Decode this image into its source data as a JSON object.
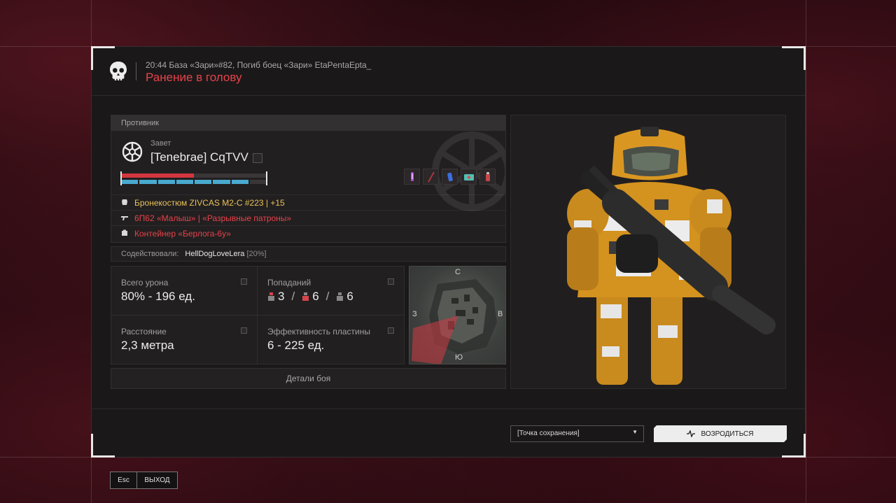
{
  "header": {
    "event_line": "20:44 База «Зари»#82, Погиб боец «Зари» EtaPentaEpta_",
    "death_cause": "Ранение в голову"
  },
  "enemy": {
    "section_title": "Противник",
    "faction": "Завет",
    "player_name": "[Tenebrae] CqTVV",
    "health_fraction": 0.5,
    "armor_fraction": 0.88,
    "items": [
      "syringe-icon",
      "knife-icon",
      "battery-icon",
      "medkit-icon",
      "stimulant-icon"
    ],
    "loadout": {
      "armor": "Бронекостюм ZIVCAS M2-C #223 | +15",
      "weapon": "6П62 «Малыш» | «Разрывные патроны»",
      "container": "Контейнер «Берлога-6у»"
    }
  },
  "assist": {
    "label": "Содействовали:",
    "name": "HellDogLoveLera",
    "percent": "[20%]"
  },
  "stats": {
    "damage_label": "Всего урона",
    "damage_value": "80% - 196 ед.",
    "hits_label": "Попаданий",
    "hits": [
      "3",
      "6",
      "6"
    ],
    "distance_label": "Расстояние",
    "distance_value": "2,3 метра",
    "plate_label": "Эффективность пластины",
    "plate_value": "6 - 225 ед."
  },
  "map": {
    "north": "С",
    "south": "Ю",
    "west": "З",
    "east": "В"
  },
  "details_button": "Детали боя",
  "respawn": {
    "select_value": "[Точка сохранения]",
    "button_label": "ВОЗРОДИТЬСЯ"
  },
  "exit": {
    "key": "Esc",
    "label": "ВЫХОД"
  },
  "colors": {
    "accent_red": "#e5434a",
    "armor_gold": "#e8c25a",
    "armor_blue": "#4aa9cf"
  }
}
